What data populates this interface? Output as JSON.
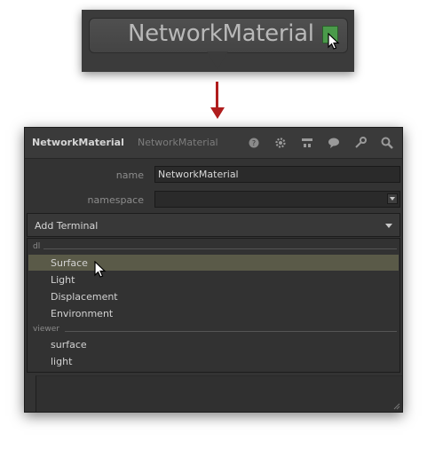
{
  "node": {
    "title": "NetworkMaterial",
    "flag_color": "#4a9a4a"
  },
  "arrow_color": "#b01d1d",
  "panel": {
    "title": "NetworkMaterial",
    "subtitle": "NetworkMaterial",
    "icons": [
      "help-icon",
      "gear-icon",
      "network-icon",
      "chat-icon",
      "wrench-icon",
      "search-icon"
    ],
    "fields": {
      "name_label": "name",
      "name_value": "NetworkMaterial",
      "namespace_label": "namespace",
      "namespace_value": ""
    },
    "combo": {
      "label": "Add Terminal"
    },
    "menu": {
      "sections": [
        {
          "label": "dl",
          "items": [
            "Surface",
            "Light",
            "Displacement",
            "Environment"
          ]
        },
        {
          "label": "viewer",
          "items": [
            "surface",
            "light"
          ]
        }
      ],
      "highlighted": "Surface",
      "highlight_color": "#5a5a48"
    }
  }
}
